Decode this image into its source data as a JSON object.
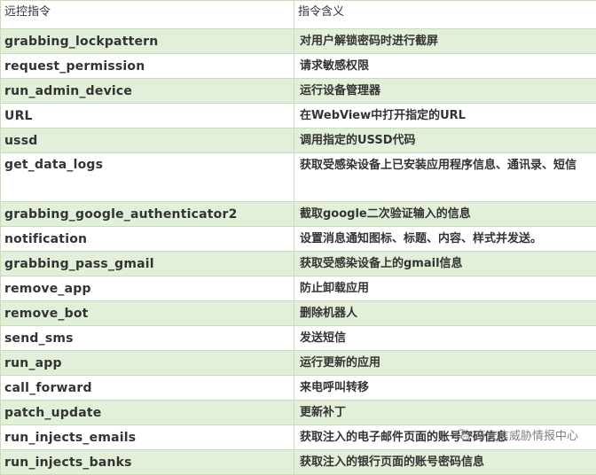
{
  "table": {
    "headers": [
      "远控指令",
      "指令含义"
    ],
    "rows": [
      {
        "cmd": "grabbing_lockpattern",
        "desc": "对用户解锁密码时进行截屏"
      },
      {
        "cmd": "request_permission",
        "desc": "请求敏感权限"
      },
      {
        "cmd": "run_admin_device",
        "desc": "运行设备管理器"
      },
      {
        "cmd": "URL",
        "desc": "在WebView中打开指定的URL"
      },
      {
        "cmd": "ussd",
        "desc": "调用指定的USSD代码"
      },
      {
        "cmd": "get_data_logs",
        "desc": "获取受感染设备上已安装应用程序信息、通讯录、短信"
      },
      {
        "cmd": "grabbing_google_authenticator2",
        "desc": "截取google二次验证输入的信息"
      },
      {
        "cmd": "notification",
        "desc": "设置消息通知图标、标题、内容、样式并发送。"
      },
      {
        "cmd": "grabbing_pass_gmail",
        "desc": "获取受感染设备上的gmail信息"
      },
      {
        "cmd": "remove_app",
        "desc": "防止卸载应用"
      },
      {
        "cmd": "remove_bot",
        "desc": "删除机器人"
      },
      {
        "cmd": "send_sms",
        "desc": "发送短信"
      },
      {
        "cmd": "run_app",
        "desc": "运行更新的应用"
      },
      {
        "cmd": "call_forward",
        "desc": "来电呼叫转移"
      },
      {
        "cmd": "patch_update",
        "desc": "更新补丁"
      },
      {
        "cmd": "run_injects_emails",
        "desc": "获取注入的电子邮件页面的账号密码信息"
      },
      {
        "cmd": "run_injects_banks",
        "desc": "获取注入的银行页面的账号密码信息"
      }
    ]
  },
  "watermark": {
    "text": "奇安信威胁情报中心",
    "icon": "wechat-icon"
  }
}
